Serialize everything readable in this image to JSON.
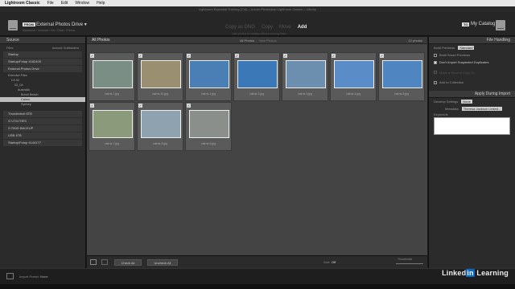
{
  "menubar": {
    "apple": "",
    "app": "Lightroom Classic",
    "items": [
      "File",
      "Edit",
      "Window",
      "Help"
    ]
  },
  "window_title": "Lightroom Essential Training (Cat) – Adobe Photoshop Lightroom Classic – Library",
  "header": {
    "from_badge": "FROM",
    "source_name": "External Photos Drive ▾",
    "source_path": "Macintosh / Volumes / Ext / Drive / Photos",
    "modes": [
      "Copy as DNG",
      "Copy",
      "Move",
      "Add"
    ],
    "active_mode": "Add",
    "mode_sub": "Add photos to catalog without moving them",
    "to_badge": "TO",
    "dest_name": "My Catalog"
  },
  "left_panel": {
    "title": "Source",
    "files_label": "Files",
    "include_subfolders": "Include Subfolders",
    "volumes": [
      "Startup",
      "Startup/Fotop 4182409",
      "External Photos Drive"
    ],
    "tree": [
      "Exercise Files",
      "Ch 02",
      "02_04",
      "Australia",
      "Bondi Beach",
      "Cairns",
      "Sydney"
    ],
    "selected_folder": "Cairns",
    "more_volumes": [
      "Thunderbolt 6TB",
      "G UTILITIES",
      "G RAID BACKUP",
      "USB 4TB",
      "Startup/Fotop 4144177"
    ]
  },
  "grid": {
    "title": "All Photos",
    "filters": [
      "All Photos",
      "New Photos"
    ],
    "count": "12 photos",
    "photos": [
      {
        "name": "cairns-7.jpg",
        "color": "#7a8e86"
      },
      {
        "name": "cairns-10.jpg",
        "color": "#9a8f70"
      },
      {
        "name": "cairns-1.jpg",
        "color": "#4a7fb5"
      },
      {
        "name": "cairns-2.jpg",
        "color": "#3b78b8"
      },
      {
        "name": "cairns-3.jpg",
        "color": "#6c8fb0"
      },
      {
        "name": "cairns-4.jpg",
        "color": "#5a8cc8"
      },
      {
        "name": "cairns-5.jpg",
        "color": "#4f86c2"
      },
      {
        "name": "cairns-7.jpg",
        "color": "#8a9a7a"
      },
      {
        "name": "cairns-8.jpg",
        "color": "#8fa2b0"
      },
      {
        "name": "cairns-9.jpg",
        "color": "#8a8f8c"
      }
    ]
  },
  "toolbar": {
    "check_all": "Check All",
    "uncheck_all": "Uncheck All",
    "sort_label": "Sort:",
    "sort_value": "Off",
    "thumbnails": "Thumbnails"
  },
  "right_panel": {
    "file_handling_title": "File Handling",
    "build_previews_label": "Build Previews",
    "build_previews_value": "Standard",
    "smart_previews": "Build Smart Previews",
    "dont_import_dupes": "Don't Import Suspected Duplicates",
    "second_copy": "Make a Second Copy To:",
    "add_to_collection": "Add to Collection",
    "apply_title": "Apply During Import",
    "develop_label": "Develop Settings",
    "develop_value": "None",
    "metadata_label": "Metadata",
    "metadata_value": "Theresa Jackson Linked...",
    "keywords_label": "Keywords"
  },
  "bottom": {
    "import_presets": "Import Preset :",
    "preset_value": "None",
    "watermark": "Linked",
    "watermark_in": "in",
    "watermark_end": " Learning"
  }
}
